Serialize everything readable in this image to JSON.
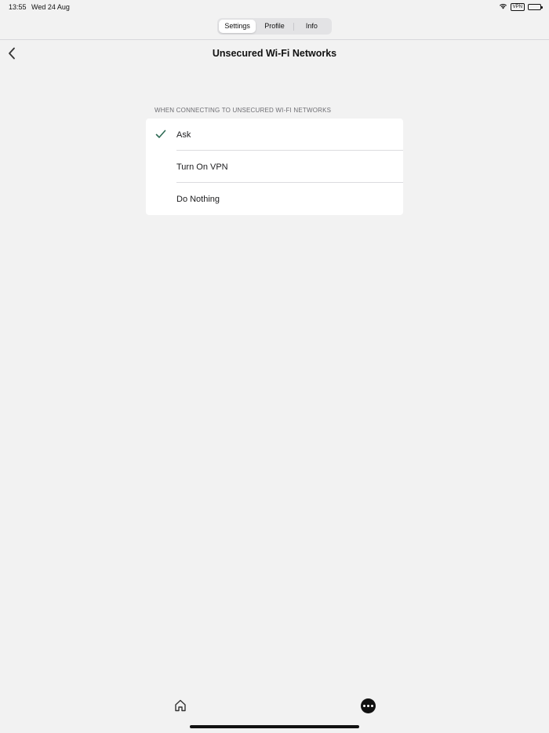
{
  "status_bar": {
    "time": "13:55",
    "date": "Wed 24 Aug",
    "vpn": "VPN",
    "icons": [
      "wifi-icon",
      "vpn-badge",
      "battery-icon"
    ]
  },
  "segmented_control": {
    "tabs": [
      {
        "label": "Settings",
        "selected": true
      },
      {
        "label": "Profile",
        "selected": false
      },
      {
        "label": "Info",
        "selected": false
      }
    ]
  },
  "nav": {
    "back_icon": "chevron-left-icon",
    "title": "Unsecured Wi-Fi Networks"
  },
  "section": {
    "header": "WHEN CONNECTING TO UNSECURED WI-FI NETWORKS",
    "options": [
      {
        "label": "Ask",
        "selected": true
      },
      {
        "label": "Turn On VPN",
        "selected": false
      },
      {
        "label": "Do Nothing",
        "selected": false
      }
    ]
  },
  "tab_bar": {
    "items": [
      {
        "icon": "home-icon"
      },
      {
        "icon": "more-icon"
      }
    ]
  },
  "colors": {
    "background": "#f2f2f2",
    "check": "#2f6b55",
    "text": "#1c1c1e",
    "secondary_text": "#6d6d72"
  }
}
